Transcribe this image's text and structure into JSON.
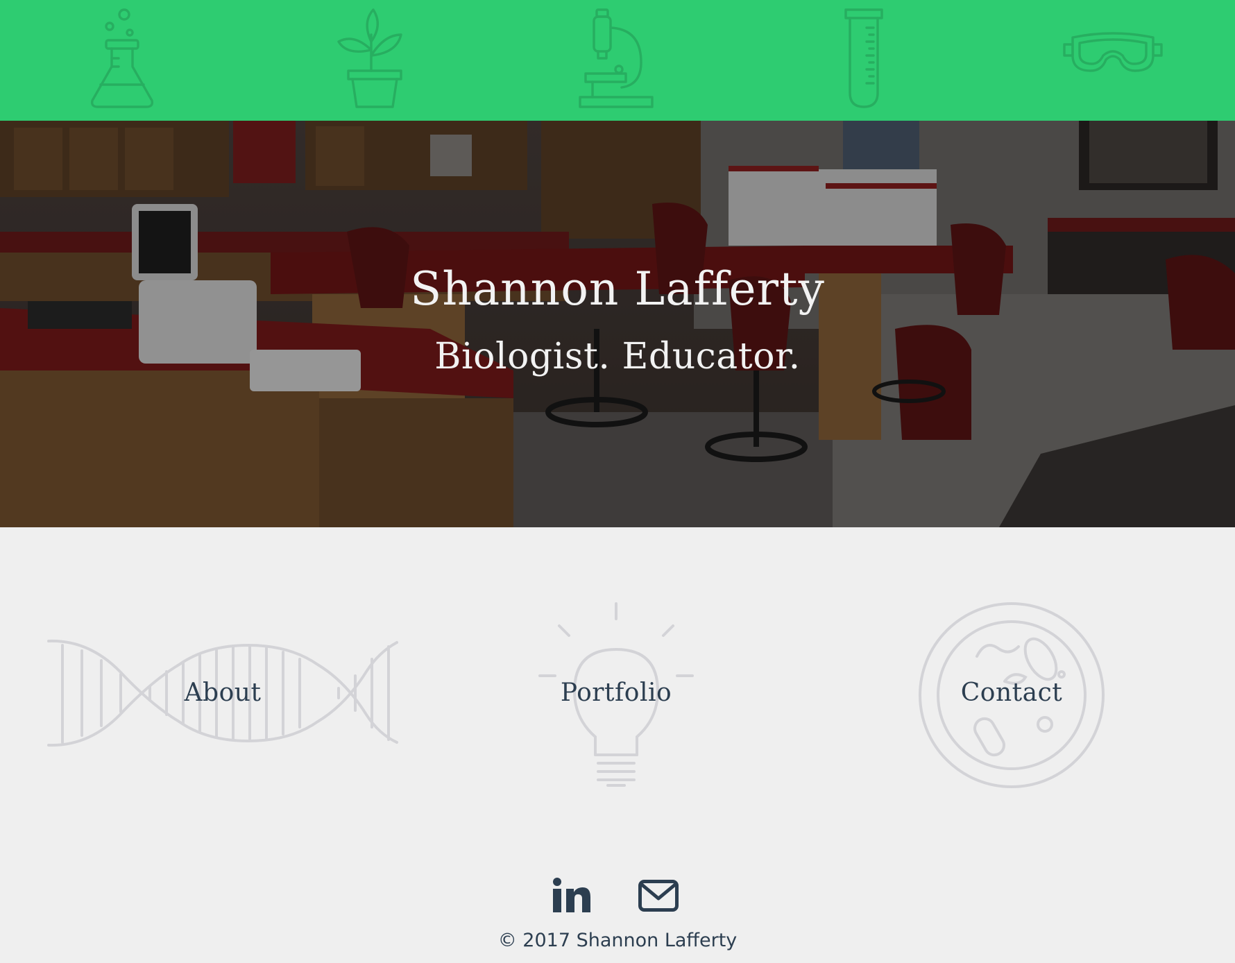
{
  "header": {
    "background_color": "#2ecc71",
    "icon_color": "#27ae60",
    "icons": [
      "flask-icon",
      "plant-icon",
      "microscope-icon",
      "test-tube-icon",
      "goggles-icon"
    ]
  },
  "hero": {
    "title": "Shannon Lafferty",
    "subtitle": "Biologist. Educator.",
    "background_image": "science-lab-classroom"
  },
  "nav": {
    "items": [
      {
        "label": "About",
        "icon": "dna-icon"
      },
      {
        "label": "Portfolio",
        "icon": "lightbulb-icon"
      },
      {
        "label": "Contact",
        "icon": "petri-dish-icon"
      }
    ],
    "label_color": "#2c3e50",
    "icon_color": "#d3d3d7"
  },
  "footer": {
    "social": [
      {
        "name": "LinkedIn",
        "icon": "linkedin-icon"
      },
      {
        "name": "Email",
        "icon": "envelope-icon"
      }
    ],
    "copyright": "© 2017 Shannon Lafferty"
  }
}
